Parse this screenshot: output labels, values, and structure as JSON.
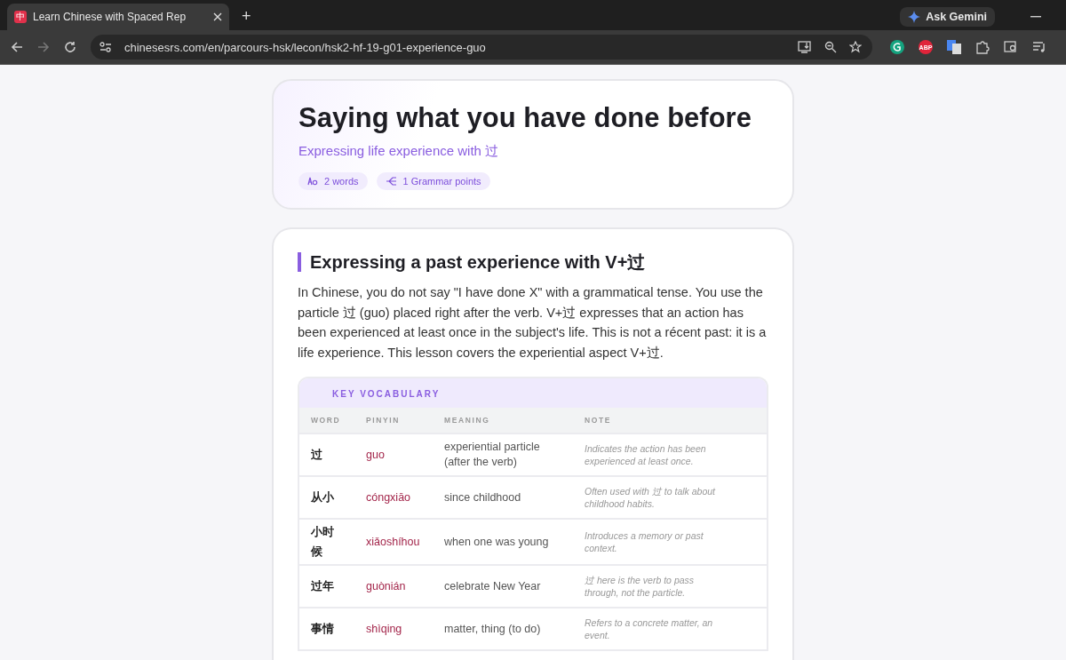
{
  "browser": {
    "tab": {
      "favicon": "中",
      "title": "Learn Chinese with Spaced Rep",
      "selected": true
    },
    "new_tab": "+",
    "ask_gemini": "Ask Gemini",
    "url": "chinesesrs.com/en/parcours-hsk/lecon/hsk2-hf-19-g01-experience-guo",
    "abp_badge": "ABP"
  },
  "lesson": {
    "title": "Saying what you have done before",
    "subtitle": "Expressing life experience with 过",
    "chips": [
      {
        "kind": "words",
        "label": "2 words"
      },
      {
        "kind": "grammar",
        "label": "1 Grammar points"
      }
    ]
  },
  "section": {
    "heading": "Expressing a past experience with V+过",
    "paragraph": "In Chinese, you do not say \"I have done X\" with a grammatical tense. You use the particle 过 (guo) placed right after the verb. V+过 expresses that an action has been experienced at least once in the subject's life. This is not a récent past: it is a life experience. This lesson covers the experiential aspect V+过.",
    "table": {
      "title": "KEY VOCABULARY",
      "columns": [
        "WORD",
        "PINYIN",
        "MEANING",
        "NOTE"
      ],
      "rows": [
        {
          "word": "过",
          "pinyin": "guo",
          "meaning": "experiential particle (after the verb)",
          "note": "Indicates the action has been experienced at least once."
        },
        {
          "word": "从小",
          "pinyin": "cóngxiāo",
          "meaning": "since childhood",
          "note": "Often used with 过 to talk about childhood habits."
        },
        {
          "word": "小时候",
          "pinyin": "xiǎoshíhou",
          "meaning": "when one was young",
          "note": "Introduces a memory or past context."
        },
        {
          "word": "过年",
          "pinyin": "guònián",
          "meaning": "celebrate New Year",
          "note": "过 here is the verb to pass through, not the particle."
        },
        {
          "word": "事情",
          "pinyin": "shìqing",
          "meaning": "matter, thing (to do)",
          "note": "Refers to a concrete matter, an event."
        }
      ]
    }
  }
}
